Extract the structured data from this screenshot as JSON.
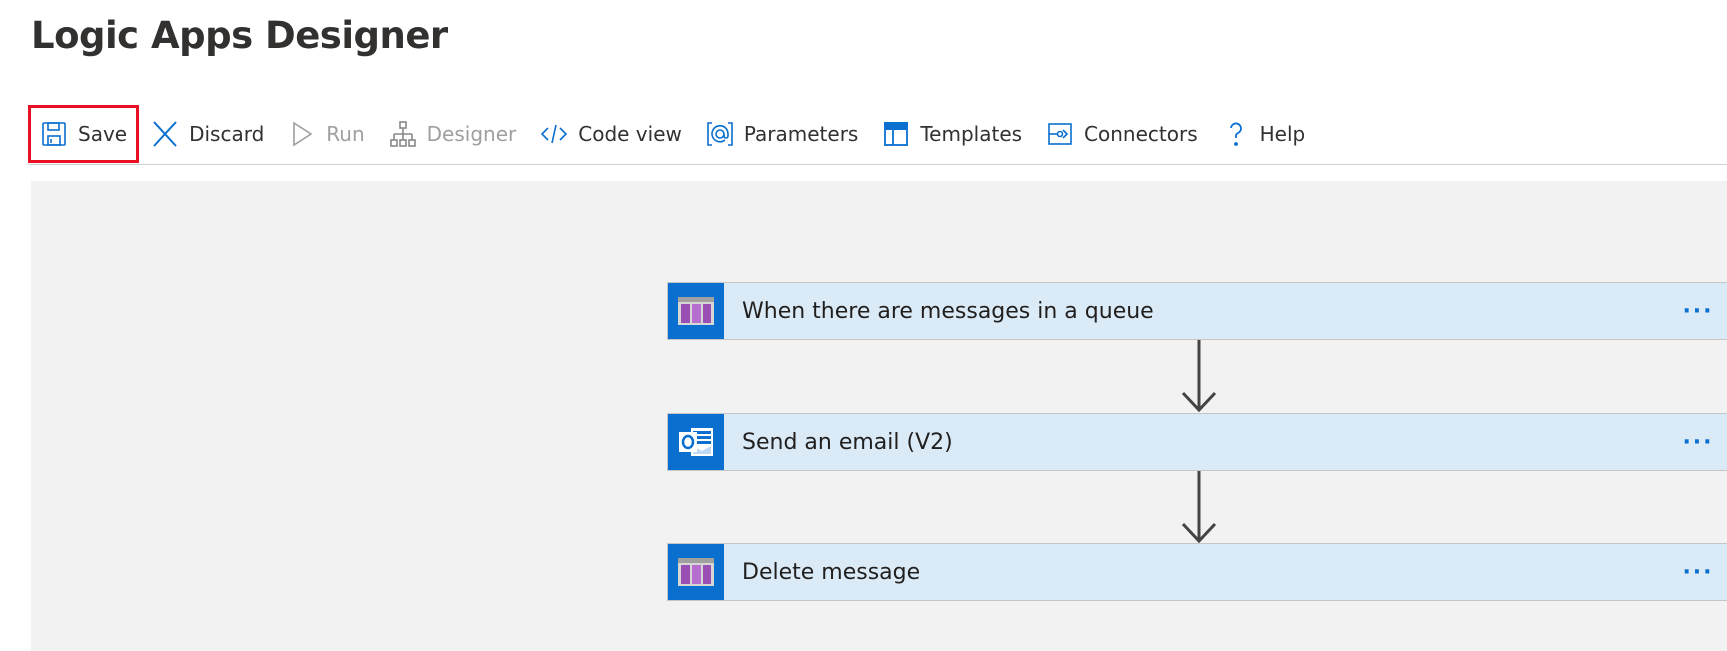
{
  "page": {
    "title": "Logic Apps Designer"
  },
  "toolbar": {
    "items": [
      {
        "key": "save",
        "label": "Save",
        "icon": "save-icon",
        "disabled": false,
        "highlighted": true
      },
      {
        "key": "discard",
        "label": "Discard",
        "icon": "discard-icon",
        "disabled": false
      },
      {
        "key": "run",
        "label": "Run",
        "icon": "run-icon",
        "disabled": true
      },
      {
        "key": "designer",
        "label": "Designer",
        "icon": "designer-icon",
        "disabled": true
      },
      {
        "key": "code_view",
        "label": "Code view",
        "icon": "code-view-icon",
        "disabled": false
      },
      {
        "key": "parameters",
        "label": "Parameters",
        "icon": "parameters-icon",
        "disabled": false
      },
      {
        "key": "templates",
        "label": "Templates",
        "icon": "templates-icon",
        "disabled": false
      },
      {
        "key": "connectors",
        "label": "Connectors",
        "icon": "connectors-icon",
        "disabled": false
      },
      {
        "key": "help",
        "label": "Help",
        "icon": "help-icon",
        "disabled": false
      }
    ]
  },
  "workflow": {
    "steps": [
      {
        "title": "When there are messages in a queue",
        "icon": "storage-queue-icon"
      },
      {
        "title": "Send an email (V2)",
        "icon": "outlook-icon"
      },
      {
        "title": "Delete message",
        "icon": "storage-queue-icon"
      }
    ],
    "menu_glyph": "···"
  },
  "colors": {
    "accent": "#0a6fcf",
    "highlight": "#e81123",
    "card_bg": "#dbeaf7",
    "canvas_bg": "#f2f2f2",
    "disabled_text": "#a19f9d"
  }
}
